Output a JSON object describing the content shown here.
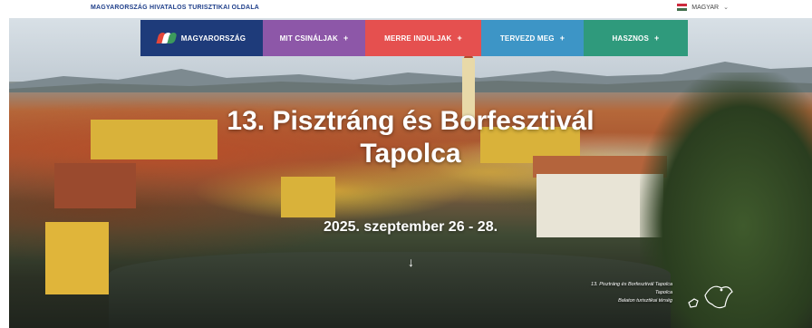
{
  "topbar": {
    "official_label": "MAGYARORSZÁG HIVATALOS TURISZTIKAI OLDALA",
    "language_label": "MAGYAR",
    "flag_colors": [
      "#cd2a3e",
      "#ffffff",
      "#436f4d"
    ]
  },
  "nav": {
    "brand": "MAGYARORSZÁG",
    "items": [
      {
        "label": "MIT CSINÁLJAK",
        "color": "#8d57a8"
      },
      {
        "label": "MERRE INDULJAK",
        "color": "#e5504f"
      },
      {
        "label": "TERVEZD MEG",
        "color": "#3d95c6"
      },
      {
        "label": "HASZNOS",
        "color": "#2f9a7c"
      }
    ],
    "brand_color": "#1e3b7a",
    "item_icon": "plus-icon"
  },
  "hero": {
    "title_line1": "13. Pisztráng és Borfesztivál",
    "title_line2": "Tapolca",
    "date": "2025. szeptember 26 - 28.",
    "scroll_icon": "arrow-down-icon",
    "caption": {
      "line1": "13. Pisztráng és Borfesztivál Tapolca",
      "line2": "Tapolca",
      "line3": "Balaton turisztikai térség"
    },
    "caption_icon": "region-map-icon"
  }
}
